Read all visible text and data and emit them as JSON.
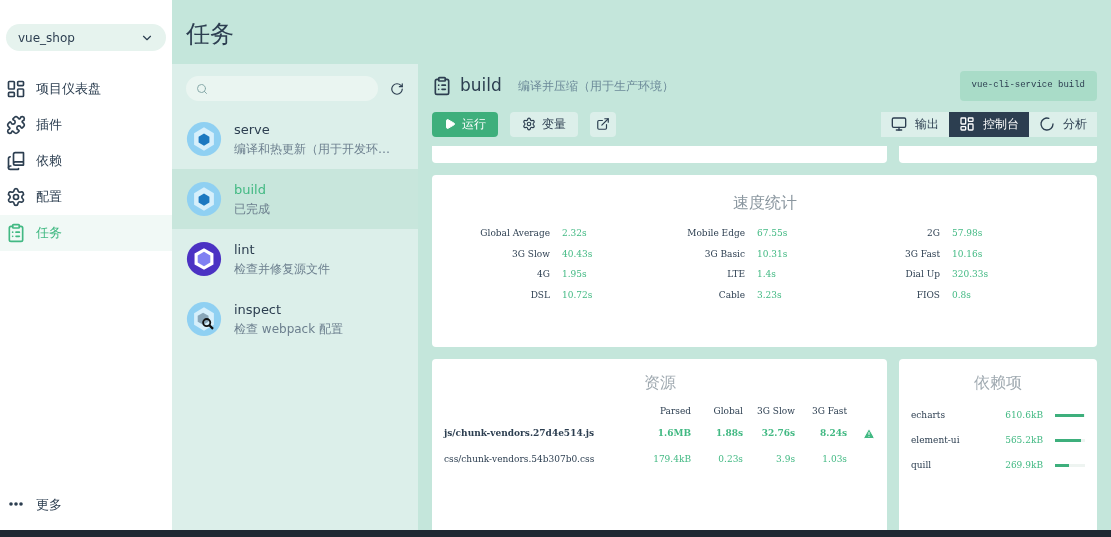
{
  "project_selector": {
    "value": "vue_shop"
  },
  "nav": [
    {
      "label": "项目仪表盘",
      "selected": false
    },
    {
      "label": "插件",
      "selected": false
    },
    {
      "label": "依赖",
      "selected": false
    },
    {
      "label": "配置",
      "selected": false
    },
    {
      "label": "任务",
      "selected": true
    }
  ],
  "more": {
    "label": "更多"
  },
  "page_title": "任务",
  "tasks": [
    {
      "name": "serve",
      "description": "编译和热更新（用于开发环…",
      "selected": false
    },
    {
      "name": "build",
      "description": "已完成",
      "selected": true
    },
    {
      "name": "lint",
      "description": "检查并修复源文件",
      "selected": false
    },
    {
      "name": "inspect",
      "description": "检查 webpack 配置",
      "selected": false
    }
  ],
  "task_header": {
    "name": "build",
    "description": "编译并压缩（用于生产环境）",
    "command": "vue-cli-service build"
  },
  "actions": [
    {
      "label": "运行",
      "kind": "primary"
    },
    {
      "label": "变量",
      "kind": "settings"
    },
    {
      "kind": "open"
    }
  ],
  "views": [
    {
      "label": "输出",
      "selected": false
    },
    {
      "label": "控制台",
      "selected": true
    },
    {
      "label": "分析",
      "selected": false
    }
  ],
  "speed_stats": {
    "title": "速度统计",
    "items": [
      {
        "label": "Global Average",
        "value": "2.32s"
      },
      {
        "label": "Mobile Edge",
        "value": "67.55s"
      },
      {
        "label": "2G",
        "value": "57.98s"
      },
      {
        "label": "3G Slow",
        "value": "40.43s"
      },
      {
        "label": "3G Basic",
        "value": "10.31s"
      },
      {
        "label": "3G Fast",
        "value": "10.16s"
      },
      {
        "label": "4G",
        "value": "1.95s"
      },
      {
        "label": "LTE",
        "value": "1.4s"
      },
      {
        "label": "Dial Up",
        "value": "320.33s"
      },
      {
        "label": "DSL",
        "value": "10.72s"
      },
      {
        "label": "Cable",
        "value": "3.23s"
      },
      {
        "label": "FIOS",
        "value": "0.8s"
      }
    ]
  },
  "assets": {
    "title": "资源",
    "columns": [
      "Parsed",
      "Global",
      "3G Slow",
      "3G Fast"
    ],
    "rows": [
      {
        "name": "js/chunk-vendors.27d4e514.js",
        "cells": [
          "1.6MB",
          "1.88s",
          "32.76s",
          "8.24s"
        ],
        "warning": true
      },
      {
        "name": "css/chunk-vendors.54b307b0.css",
        "cells": [
          "179.4kB",
          "0.23s",
          "3.9s",
          "1.03s"
        ],
        "warning": false
      }
    ]
  },
  "dependencies": {
    "title": "依赖项",
    "rows": [
      {
        "name": "echarts",
        "size": "610.6kB",
        "level": 0.95
      },
      {
        "name": "element-ui",
        "size": "565.2kB",
        "level": 0.88
      },
      {
        "name": "quill",
        "size": "269.9kB",
        "level": 0.45
      }
    ]
  }
}
